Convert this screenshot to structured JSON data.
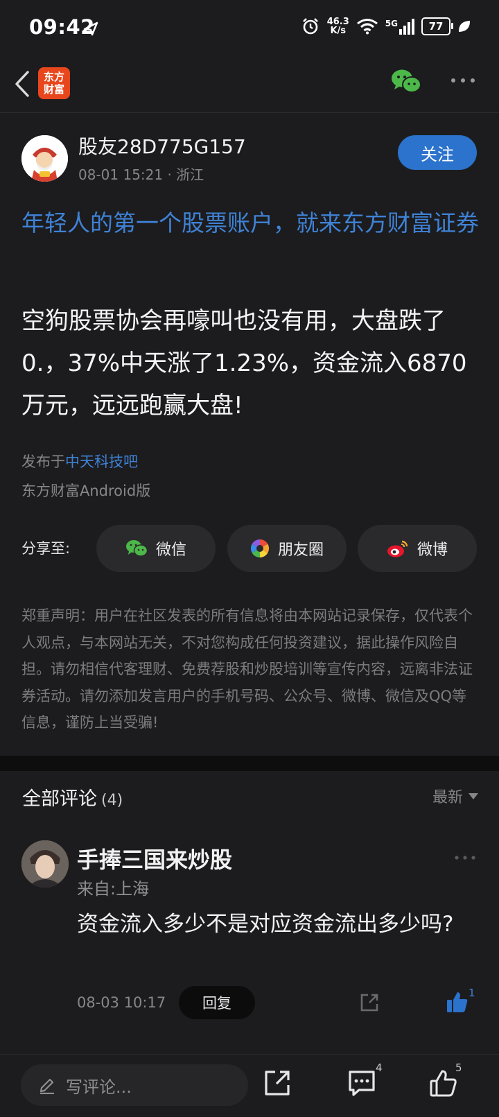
{
  "status_bar": {
    "time": "09:42",
    "net_speed_value": "46.3",
    "net_speed_unit": "K/s",
    "signal": "5G",
    "battery": "77"
  },
  "nav": {
    "logo_line1": "东方",
    "logo_line2": "财富"
  },
  "post": {
    "author": "股友28D775G157",
    "meta": "08-01 15:21 · 浙江",
    "follow_label": "关注",
    "promo": "年轻人的第一个股票账户，就来东方财富证券",
    "body": "空狗股票协会再嚎叫也没有用，大盘跌了0.，37%中天涨了1.23%，资金流入6870万元，远远跑赢大盘!",
    "published_prefix": "发布于",
    "bar_name": "中天科技吧",
    "client": "东方财富Android版"
  },
  "share": {
    "label": "分享至:",
    "wechat": "微信",
    "moments": "朋友圈",
    "weibo": "微博"
  },
  "disclaimer": "郑重声明：用户在社区发表的所有信息将由本网站记录保存，仅代表个人观点，与本网站无关，不对您构成任何投资建议，据此操作风险自担。请勿相信代客理财、免费荐股和炒股培训等宣传内容，远离非法证券活动。请勿添加发言用户的手机号码、公众号、微博、微信及QQ等信息，谨防上当受骗!",
  "comments": {
    "title": "全部评论",
    "count": "(4)",
    "sort": "最新",
    "items": [
      {
        "name": "手捧三国来炒股",
        "from": "来自:上海",
        "body": "资金流入多少不是对应资金流出多少吗?",
        "time": "08-03 10:17",
        "reply_label": "回复",
        "likes": "1"
      }
    ]
  },
  "bottom_bar": {
    "placeholder": "写评论...",
    "comment_count": "4",
    "like_count": "5"
  },
  "colors": {
    "background": "#1c1c1e",
    "accent": "#2b73cc",
    "link": "#3f82d6"
  }
}
